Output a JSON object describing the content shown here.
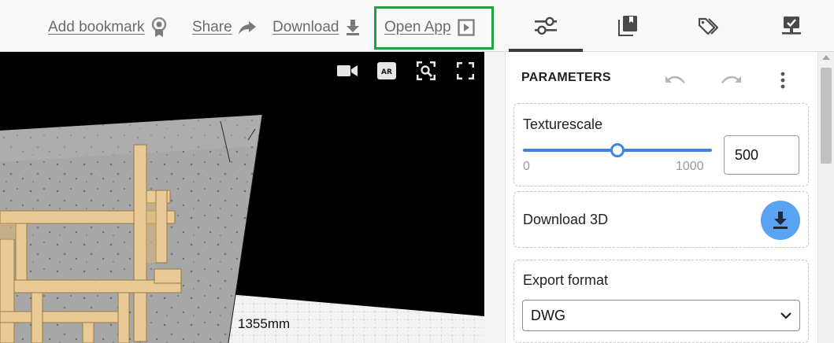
{
  "toolbar": {
    "add_bookmark": "Add bookmark",
    "share": "Share",
    "download": "Download",
    "open_app": "Open App"
  },
  "tabs": [
    {
      "icon": "sliders-icon",
      "active": true
    },
    {
      "icon": "library-icon",
      "active": false
    },
    {
      "icon": "tags-icon",
      "active": false
    },
    {
      "icon": "checklist-screen-icon",
      "active": false
    }
  ],
  "viewer": {
    "icons": [
      "video-camera-icon",
      "ar-icon",
      "zoom-fit-icon",
      "fullscreen-icon"
    ],
    "dimension_label": "1355mm"
  },
  "panel": {
    "title": "PARAMETERS",
    "texturescale": {
      "label": "Texturescale",
      "min": "0",
      "max": "1000",
      "value": "500",
      "fraction": 0.5
    },
    "download3d": {
      "label": "Download 3D"
    },
    "export_format": {
      "label": "Export format",
      "selected": "DWG"
    }
  },
  "colors": {
    "accent": "#3f86e0",
    "highlight_frame": "#22a33f",
    "download_button": "#5aa2f2"
  }
}
